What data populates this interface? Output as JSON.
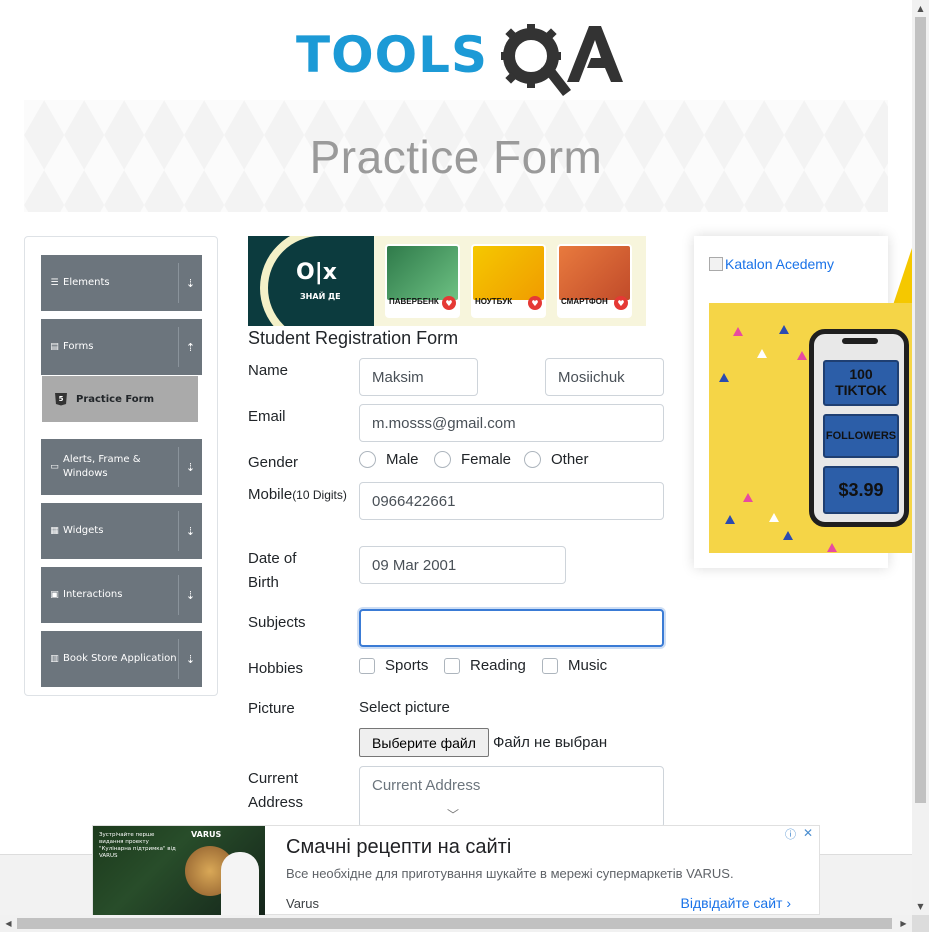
{
  "header": {
    "logo_text": "TOOLSQA"
  },
  "banner": {
    "title": "Practice Form"
  },
  "sidebar": {
    "groups": [
      {
        "label": "Elements",
        "icon": "list-icon"
      },
      {
        "label": "Forms",
        "icon": "form-icon",
        "expanded": true
      },
      {
        "label": "Alerts, Frame & Windows",
        "icon": "window-icon"
      },
      {
        "label": "Widgets",
        "icon": "grid-icon"
      },
      {
        "label": "Interactions",
        "icon": "interaction-icon"
      },
      {
        "label": "Book Store Application",
        "icon": "chart-icon"
      }
    ],
    "active_item": "Practice Form"
  },
  "top_ad": {
    "brand": "O|x",
    "tagline": "ЗНАЙ ДЕ",
    "cards": [
      "ПАВЕРБЕНК",
      "НОУТБУК",
      "СМАРТФОН"
    ]
  },
  "form": {
    "title": "Student Registration Form",
    "name_label": "Name",
    "first_name": "Maksim",
    "last_name": "Mosiichuk",
    "email_label": "Email",
    "email": "m.mosss@gmail.com",
    "gender_label": "Gender",
    "genders": [
      "Male",
      "Female",
      "Other"
    ],
    "mobile_label": "Mobile",
    "mobile_hint": "(10 Digits)",
    "mobile": "0966422661",
    "dob_label_1": "Date of",
    "dob_label_2": "Birth",
    "dob": "09 Mar 2001",
    "subjects_label": "Subjects",
    "subjects": "",
    "hobbies_label": "Hobbies",
    "hobbies": [
      "Sports",
      "Reading",
      "Music"
    ],
    "picture_label": "Picture",
    "select_picture": "Select picture",
    "file_button": "Выберите файл",
    "file_status": "Файл не выбран",
    "address_label_1": "Current",
    "address_label_2": "Address",
    "address_placeholder": "Current Address"
  },
  "right_ad": {
    "link_text": "Katalon Acedemy",
    "box1_line1": "100",
    "box1_line2": "TIKTOK",
    "box2": "FOLLOWERS",
    "box3": "$3.99"
  },
  "bottom_ad": {
    "image_text": "Зустрічайте перше видання проекту \"Кулінарна підтримка\" від VARUS",
    "image_logo": "VARUS",
    "title": "Смачні рецепти на сайті",
    "description": "Все необхідне для приготування шукайте в мережі супермаркетів VARUS.",
    "source": "Varus",
    "cta": "Відвідайте сайт"
  },
  "colors": {
    "accent": "#1c9ad6",
    "sidebar": "#6c757d",
    "link": "#1a73e8"
  }
}
